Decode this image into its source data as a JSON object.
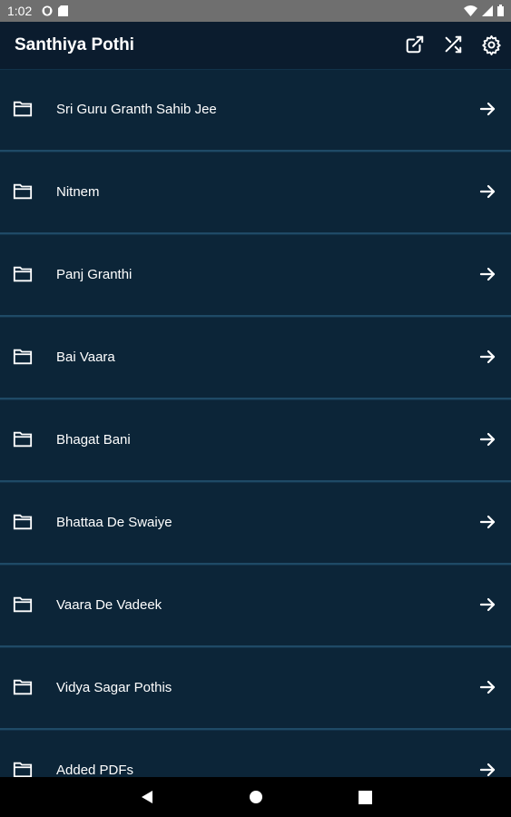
{
  "status": {
    "time": "1:02",
    "left_icons": [
      "shield-icon",
      "sd-card-icon"
    ],
    "right_icons": [
      "wifi-icon",
      "signal-icon",
      "battery-icon"
    ]
  },
  "app_bar": {
    "title": "Santhiya Pothi",
    "actions": [
      "open-external-icon",
      "shuffle-icon",
      "settings-icon"
    ]
  },
  "menu": {
    "items": [
      {
        "label": "Sri Guru Granth Sahib Jee"
      },
      {
        "label": "Nitnem"
      },
      {
        "label": "Panj Granthi"
      },
      {
        "label": "Bai Vaara"
      },
      {
        "label": "Bhagat Bani"
      },
      {
        "label": "Bhattaa De Swaiye"
      },
      {
        "label": "Vaara De Vadeek"
      },
      {
        "label": "Vidya Sagar Pothis"
      },
      {
        "label": "Added PDFs"
      }
    ]
  },
  "nav": {
    "buttons": [
      "back-icon",
      "home-icon",
      "recents-icon"
    ]
  },
  "colors": {
    "background": "#0b2133",
    "app_bar": "#0b1c2e",
    "divider": "#1f4a66",
    "status_bar": "#6f6f6f",
    "text": "#ffffff"
  }
}
